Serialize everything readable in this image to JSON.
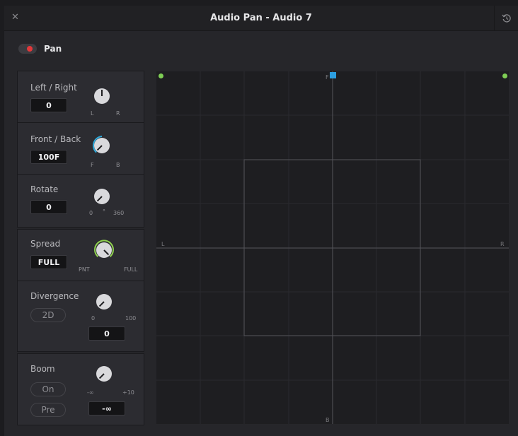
{
  "window": {
    "title": "Audio Pan - Audio 7"
  },
  "pan": {
    "label": "Pan",
    "enabled": true,
    "toggle_color": "#e2383a"
  },
  "controls": {
    "left_right": {
      "label": "Left / Right",
      "value": "0",
      "min_label": "L",
      "max_label": "R"
    },
    "front_back": {
      "label": "Front / Back",
      "value": "100F",
      "min_label": "F",
      "max_label": "B",
      "arc_color": "#2ea7d8"
    },
    "rotate": {
      "label": "Rotate",
      "value": "0",
      "min_label": "0",
      "mid_label": "°",
      "max_label": "360"
    },
    "spread": {
      "label": "Spread",
      "value": "FULL",
      "min_label": "PNT",
      "max_label": "FULL",
      "arc_color": "#8fd14f"
    },
    "divergence": {
      "label": "Divergence",
      "mode": "2D",
      "value": "0",
      "min_label": "0",
      "max_label": "100"
    },
    "boom": {
      "label": "Boom",
      "on_label": "On",
      "pre_label": "Pre",
      "value": "-∞",
      "min_label": "-∞",
      "max_label": "+10"
    }
  },
  "pan_grid": {
    "front_label": "F",
    "back_label": "B",
    "left_label": "L",
    "right_label": "R",
    "marker_color": "#2c9ee0",
    "speaker_color": "#7fcf55"
  }
}
